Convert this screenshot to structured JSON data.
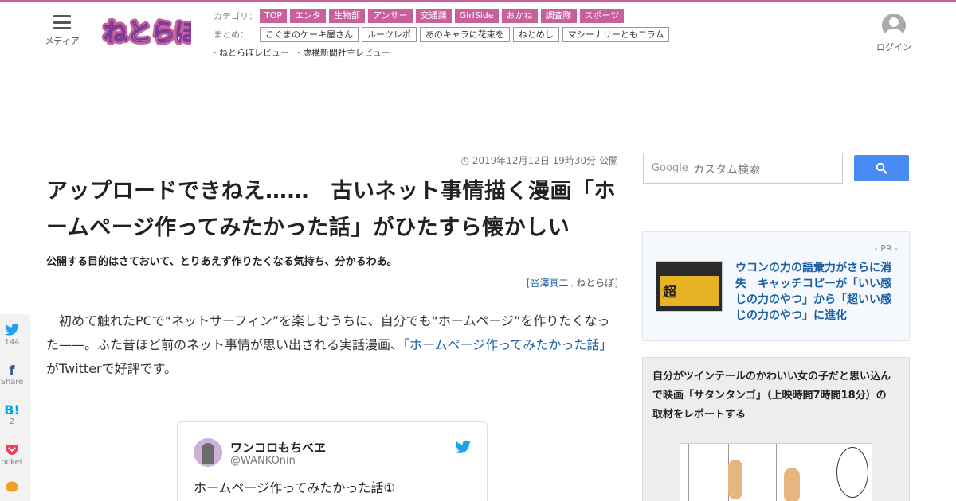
{
  "header": {
    "media_label": "メディア",
    "logo_text": "ねとらぼ",
    "category_label": "カテゴリ：",
    "categories": [
      "TOP",
      "エンタ",
      "生物部",
      "アンサー",
      "交通課",
      "GirlSide",
      "おかね",
      "調査隊",
      "スポーツ"
    ],
    "matome_label": "まとめ：",
    "matome": [
      "こぐまのケーキ屋さん",
      "ルーツレポ",
      "あのキャラに花束を",
      "ねとめし",
      "マシーナリーともコラム"
    ],
    "reviews": [
      "· ねとらぼレビュー",
      "· 虚構新聞社主レビュー"
    ],
    "login_label": "ログイン"
  },
  "article": {
    "pubdate": "2019年12月12日 19時30分 公開",
    "title": "アップロードできねえ……　古いネット事情描く漫画「ホームページ作ってみたかった話」がひたすら懐かしい",
    "subtitle": "公開する目的はさておいて、とりあえず作りたくなる気持ち、分かるわあ。",
    "byline_open": "[",
    "author": "沓澤真二",
    "byline_sep": ",",
    "source": "ねとらぼ",
    "byline_close": "]",
    "body_before": "初めて触れたPCで“ネットサーフィン”を楽しむうちに、自分でも“ホームページ”を作りたくなった——。ふた昔ほど前のネット事情が思い出される実話漫画、",
    "body_link": "「ホームページ作ってみたかった話」",
    "body_after": "がTwitterで好評です。"
  },
  "share": {
    "twitter_icon": "twitter-icon",
    "twitter_count": "144",
    "facebook_label": "Share",
    "hatena_icon_text": "B!",
    "hatena_count": "2",
    "pocket_label": "ocket"
  },
  "tweet": {
    "name": "ワンコロもちべヱ",
    "handle": "@WANKOnin",
    "text": "ホームページ作ってみたかった話①"
  },
  "sidebar": {
    "search_brand": "Google",
    "search_placeholder": "カスタム検索",
    "pr_label": "- PR -",
    "pr_text": "ウコンの力の語彙力がさらに消失　キャッチコピーが「いい感じの力のやつ」から「超いい感じの力のやつ」に進化",
    "pr_thumb_text": "超",
    "feature_text": "自分がツインテールのかわいい女の子だと思い込んで映画「サタンタンゴ」（上映時間7時間18分）の取材をレポートする"
  },
  "colors": {
    "brand_pink": "#c8619a",
    "link_blue": "#1a5fa8",
    "search_blue": "#4a8af4",
    "twitter_blue": "#1da1f2"
  }
}
